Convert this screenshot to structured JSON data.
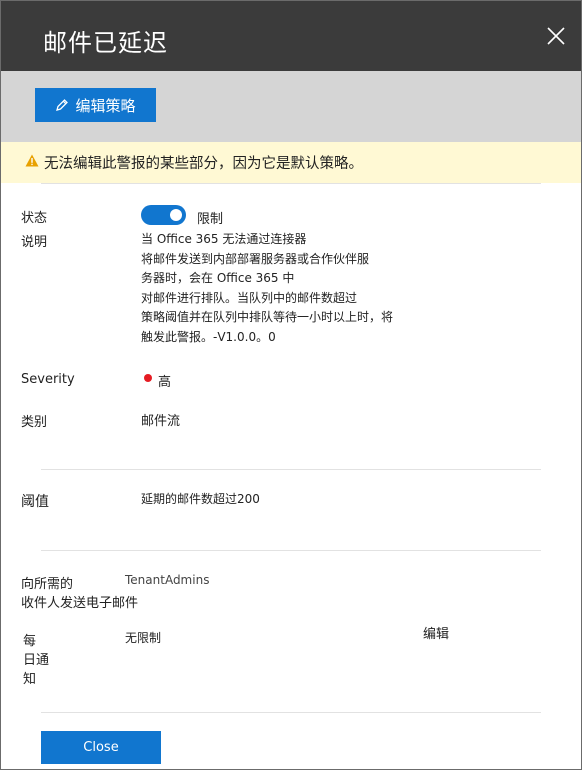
{
  "panel": {
    "title": "邮件已延迟",
    "close_icon": "close-icon"
  },
  "toolbar": {
    "edit_label": "编辑策略",
    "edit_icon": "pencil-icon"
  },
  "warning": {
    "text": "无法编辑此警报的某些部分，因为它是默认策略。",
    "icon": "warning-triangle-icon",
    "color": "#e8a100",
    "background": "#fff9d4"
  },
  "details": {
    "status_label": "状态",
    "status_value": "限制",
    "description_label": "说明",
    "description_lines": [
      "当 Office 365 无法通过连接器",
      "将邮件发送到内部部署服务器或合作伙伴服",
      "务器时，会在 Office 365 中",
      "对邮件进行排队。当队列中的邮件数超过",
      "策略阈值并在队列中排队等待一小时以上时，将",
      "触发此警报。-V1.0.0。0"
    ],
    "severity_label": "Severity",
    "severity_value": "高",
    "severity_color": "#e51c23",
    "category_label": "类别",
    "category_value": "邮件流"
  },
  "threshold": {
    "label": "阈值",
    "value": "延期的邮件数超过200"
  },
  "recipients": {
    "label_line1": "向所需的",
    "label_line2": "收件人发送电子邮件",
    "value": "TenantAdmins",
    "daily_label_lines": [
      "每",
      "日通",
      "知"
    ],
    "daily_value": "无限制",
    "edit_link": "编辑"
  },
  "footer": {
    "close_label": "Close"
  },
  "colors": {
    "header_bg": "#3b3b3b",
    "toolbar_bg": "#d5d5d5",
    "accent": "#1176cf"
  }
}
